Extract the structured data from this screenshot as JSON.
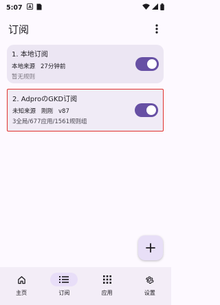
{
  "status_bar": {
    "time": "5:07"
  },
  "app_bar": {
    "title": "订阅",
    "more_icon": "more-vert-icon"
  },
  "subscriptions": [
    {
      "title": "1. 本地订阅",
      "source": "本地来源",
      "updated": "27分钟前",
      "version": "",
      "summary": "暂无规则",
      "enabled": true
    },
    {
      "title": "2. AdproのGKD订阅",
      "source": "未知来源",
      "updated": "刚刚",
      "version": "v87",
      "summary": "3全局/677应用/1561规则组",
      "enabled": true
    }
  ],
  "fab": {
    "icon": "plus-icon"
  },
  "bottom_nav": [
    {
      "label": "主页",
      "icon": "home-icon",
      "active": false
    },
    {
      "label": "订阅",
      "icon": "list-icon",
      "active": true
    },
    {
      "label": "应用",
      "icon": "apps-grid-icon",
      "active": false
    },
    {
      "label": "设置",
      "icon": "settings-gear-icon",
      "active": false
    }
  ],
  "colors": {
    "accent": "#6750a4",
    "card": "#ece6f3",
    "highlight_border": "#e0322d",
    "nav_active": "#e8def8"
  }
}
